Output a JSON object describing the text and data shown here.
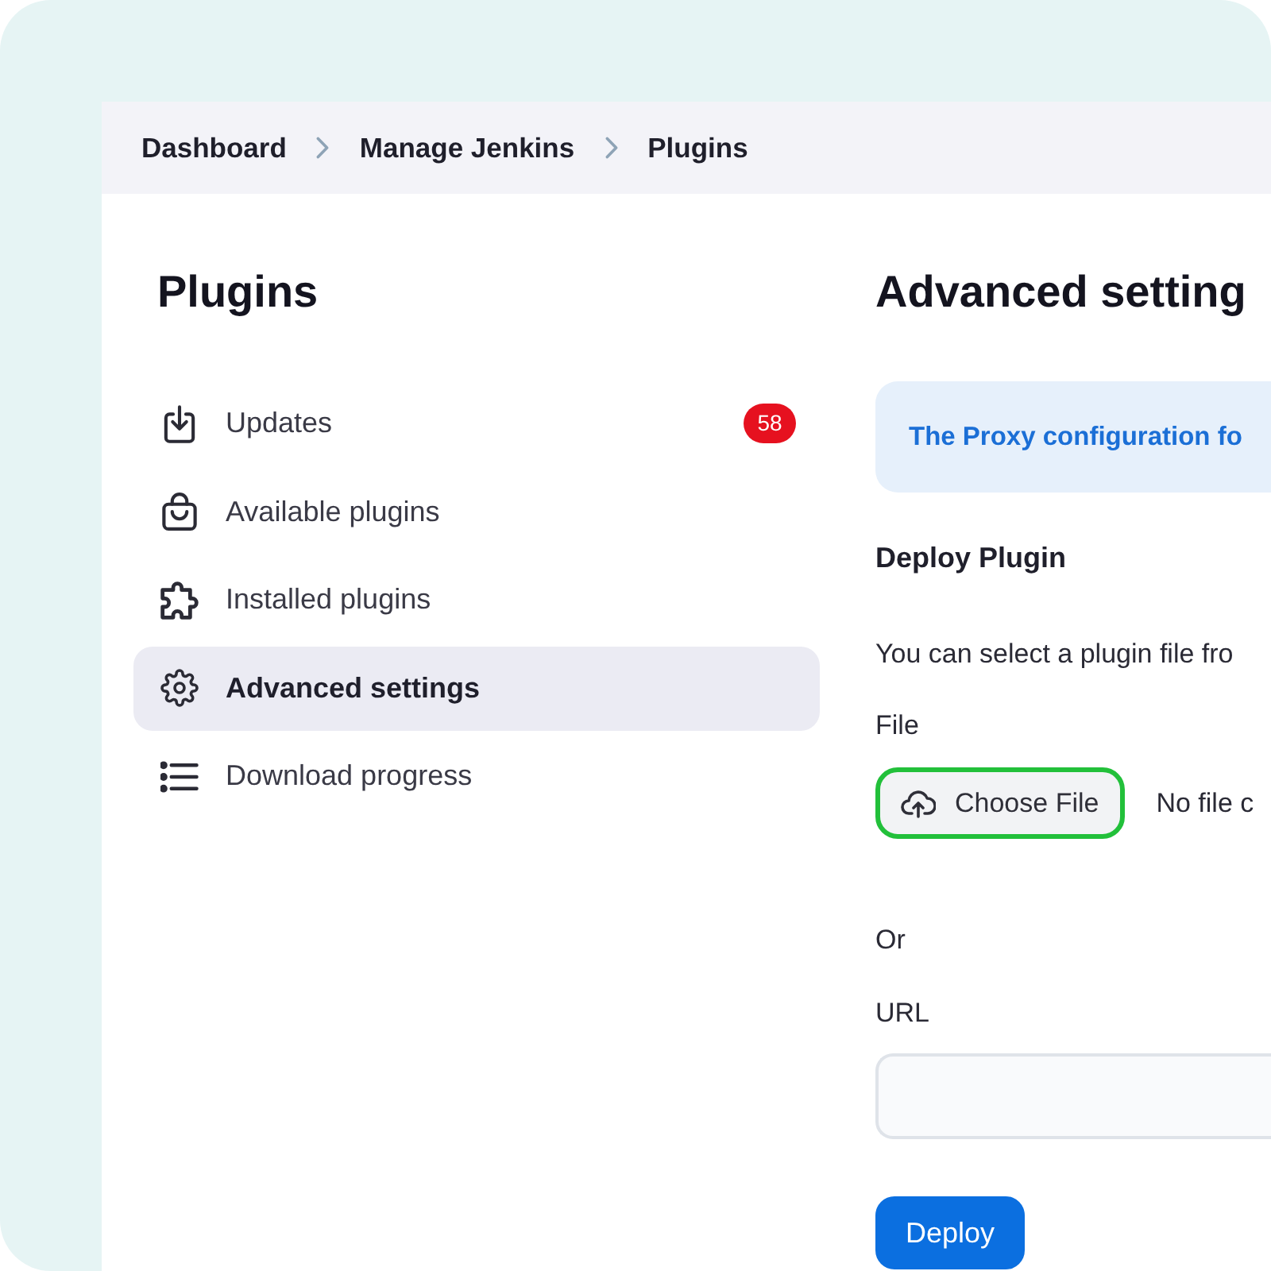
{
  "breadcrumbs": [
    "Dashboard",
    "Manage Jenkins",
    "Plugins"
  ],
  "sidebar": {
    "title": "Plugins",
    "items": [
      {
        "label": "Updates",
        "badge": "58",
        "selected": false
      },
      {
        "label": "Available plugins",
        "selected": false
      },
      {
        "label": "Installed plugins",
        "selected": false
      },
      {
        "label": "Advanced settings",
        "selected": true
      },
      {
        "label": "Download progress",
        "selected": false
      }
    ]
  },
  "main": {
    "title": "Advanced setting",
    "notice": "The Proxy configuration fo",
    "deploy_plugin": {
      "heading": "Deploy Plugin",
      "description": "You can select a plugin file fro",
      "file_label": "File",
      "choose_file_button": {
        "label": "Choose File",
        "highlighted": true
      },
      "file_status": "No file c",
      "or_text": "Or",
      "url_label": "URL",
      "deploy_button": "Deploy"
    }
  }
}
